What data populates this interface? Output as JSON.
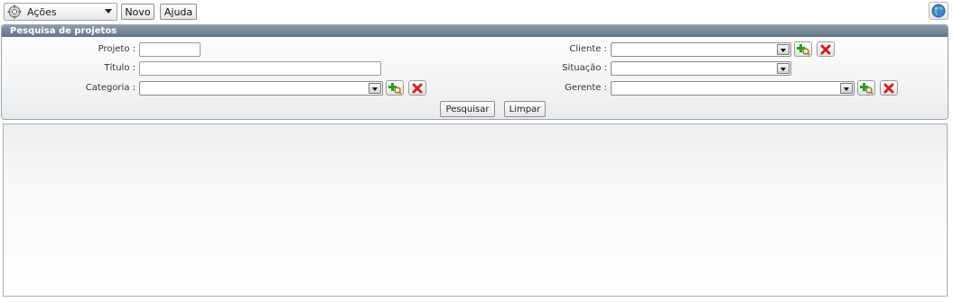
{
  "toolbar": {
    "actions_label": "Ações",
    "new_label": "Novo",
    "help_label": "Ajuda"
  },
  "search_panel": {
    "title": "Pesquisa de projetos",
    "fields": {
      "projeto": {
        "label": "Projeto :",
        "value": ""
      },
      "titulo": {
        "label": "Título :",
        "value": ""
      },
      "categoria": {
        "label": "Categoria :",
        "value": ""
      },
      "cliente": {
        "label": "Cliente :",
        "value": ""
      },
      "situacao": {
        "label": "Situação :",
        "value": ""
      },
      "gerente": {
        "label": "Gerente :",
        "value": ""
      }
    },
    "search_button": "Pesquisar",
    "clear_button": "Limpar"
  },
  "icons": {
    "actions": "gear-icon",
    "help_globe": "globe-icon",
    "add": "add-search-icon",
    "remove": "remove-x-icon"
  },
  "colors": {
    "panel_header": "#6f7f92",
    "add_green": "#2e9a2e",
    "remove_red": "#d42020"
  }
}
